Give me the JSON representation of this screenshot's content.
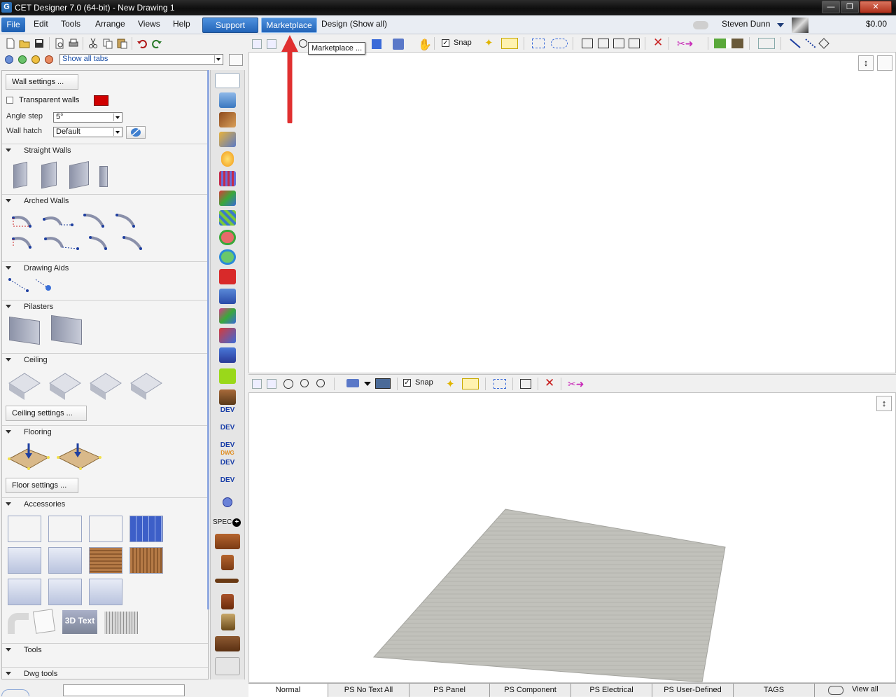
{
  "window": {
    "title": "CET Designer 7.0 (64-bit) - New Drawing 1",
    "app_icon_letter": "G"
  },
  "menu": {
    "file": "File",
    "items": [
      "Edit",
      "Tools",
      "Arrange",
      "Views",
      "Help"
    ],
    "support": "Support",
    "marketplace": "Marketplace",
    "design": "Design (Show all)",
    "user": "Steven Dunn",
    "balance": "$0.00"
  },
  "toolbar2": {
    "tabs_filter": "Show all tabs"
  },
  "tooltip": "Marketplace ...",
  "view_top": {
    "snap": "Snap"
  },
  "view_bottom": {
    "snap": "Snap"
  },
  "left_panel": {
    "wall_settings": "Wall settings ...",
    "transparent_walls": "Transparent walls",
    "transparent_walls_checked": false,
    "transparent_color": "#d00000",
    "angle_step_label": "Angle step",
    "angle_step_value": "5°",
    "wall_hatch_label": "Wall hatch",
    "wall_hatch_value": "Default",
    "sections": {
      "straight_walls": "Straight Walls",
      "arched_walls": "Arched Walls",
      "drawing_aids": "Drawing Aids",
      "pilasters": "Pilasters",
      "ceiling": "Ceiling",
      "flooring": "Flooring",
      "accessories": "Accessories",
      "tools": "Tools",
      "dwg_tools": "Dwg tools"
    },
    "ceiling_settings": "Ceiling settings ...",
    "floor_settings": "Floor settings ...",
    "text_3d": "3D Text"
  },
  "icon_strip": {
    "dev_label": "DEV",
    "spec_label": "SPEC",
    "dwg_label": "DWG"
  },
  "status_tabs": [
    "Normal",
    "PS No Text All",
    "PS Panel",
    "PS Component",
    "PS Electrical",
    "PS User-Defined",
    "TAGS",
    "View all"
  ],
  "active_status_tab": "Normal"
}
